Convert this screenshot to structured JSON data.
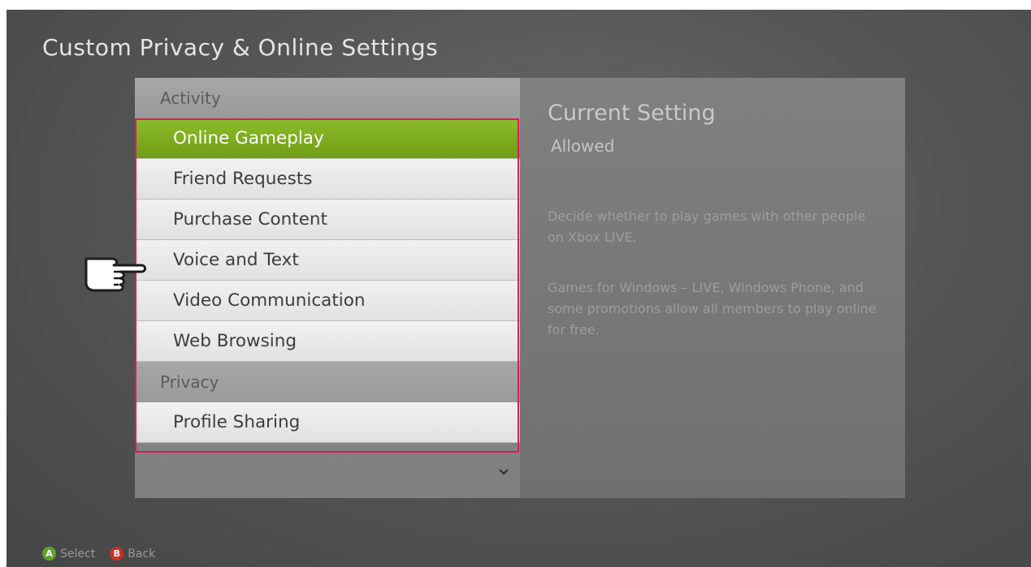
{
  "title": "Custom Privacy & Online Settings",
  "menu": {
    "sections": [
      {
        "header": "Activity",
        "items": [
          "Online Gameplay",
          "Friend Requests",
          "Purchase Content",
          "Voice and Text",
          "Video Communication",
          "Web Browsing"
        ]
      },
      {
        "header": "Privacy",
        "items": [
          "Profile Sharing"
        ]
      }
    ],
    "selected_item": "Online Gameplay",
    "scroll_icon": "chevron-down-icon"
  },
  "detail": {
    "heading": "Current Setting",
    "value": "Allowed",
    "description": [
      "Decide whether to play games with other people on Xbox LIVE.",
      "Games for Windows – LIVE, Windows Phone, and some promotions allow all members to play online for free."
    ]
  },
  "footer": {
    "a_label": "Select",
    "a_button": "A",
    "b_label": "Back",
    "b_button": "B"
  },
  "colors": {
    "selected": "#7aaa1e",
    "highlight_border": "#e0195a",
    "button_a": "#5fa32a",
    "button_b": "#c8312a"
  },
  "pointer_icon": "hand-pointer-icon"
}
